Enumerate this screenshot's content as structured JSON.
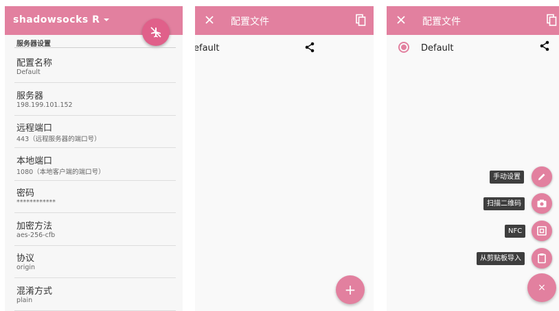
{
  "panel1": {
    "app_title": "shadowsocks R",
    "section_header": "服务器设置",
    "prefs": [
      {
        "title": "配置名称",
        "summary": "Default"
      },
      {
        "title": "服务器",
        "summary": "198.199.101.152"
      },
      {
        "title": "远程端口",
        "summary": "443（远程服务器的端口号）"
      },
      {
        "title": "本地端口",
        "summary": "1080（本地客户端的端口号）"
      },
      {
        "title": "密码",
        "summary": "************"
      },
      {
        "title": "加密方法",
        "summary": "aes-256-cfb"
      },
      {
        "title": "协议",
        "summary": "origin"
      },
      {
        "title": "混淆方式",
        "summary": "plain"
      }
    ]
  },
  "panel2": {
    "title": "配置文件",
    "profile_name": "efault",
    "fab_label": "+"
  },
  "panel3": {
    "title": "配置文件",
    "profile_name": "Default",
    "menu": {
      "manual": "手动设置",
      "scan_qr": "扫描二维码",
      "nfc": "NFC",
      "clipboard": "从剪贴板导入"
    },
    "fab_close_label": "×"
  },
  "colors": {
    "accent": "#e2809f",
    "chip_bg": "#3e3e3e"
  }
}
